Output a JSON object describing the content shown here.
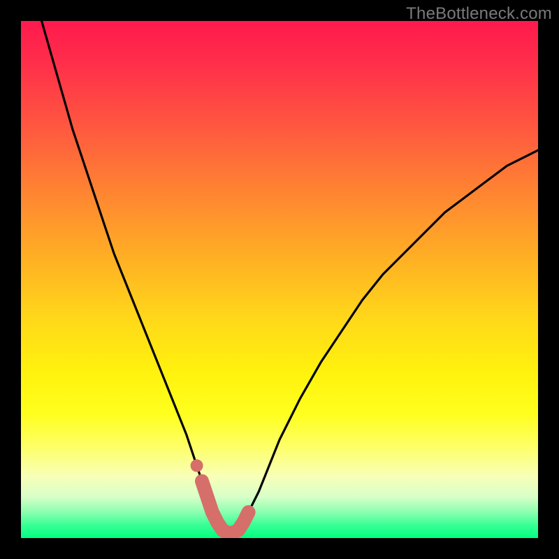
{
  "watermark": {
    "text": "TheBottleneck.com"
  },
  "colors": {
    "frame": "#000000",
    "curve": "#000000",
    "marker": "#d66e6a",
    "gradient_stops": [
      "#ff1a4d",
      "#ff2e4a",
      "#ff5640",
      "#ff8432",
      "#ffb024",
      "#ffd919",
      "#fff20e",
      "#ffff1e",
      "#feff63",
      "#f8ffb7",
      "#d8ffc8",
      "#8bffb0",
      "#38ff95",
      "#00ff80"
    ]
  },
  "chart_data": {
    "type": "line",
    "title": "",
    "xlabel": "",
    "ylabel": "",
    "xlim": [
      0,
      100
    ],
    "ylim": [
      0,
      100
    ],
    "grid": false,
    "legend": false,
    "series": [
      {
        "name": "bottleneck-curve",
        "x": [
          4,
          6,
          8,
          10,
          12,
          14,
          16,
          18,
          20,
          22,
          24,
          26,
          28,
          30,
          32,
          34,
          35,
          36,
          37,
          38,
          39,
          40,
          41,
          42,
          43,
          44,
          46,
          48,
          50,
          54,
          58,
          62,
          66,
          70,
          74,
          78,
          82,
          86,
          90,
          94,
          98,
          100
        ],
        "y": [
          100,
          93,
          86,
          79,
          73,
          67,
          61,
          55,
          50,
          45,
          40,
          35,
          30,
          25,
          20,
          14,
          11,
          8,
          5,
          3,
          1.5,
          1,
          1,
          1.5,
          3,
          5,
          9,
          14,
          19,
          27,
          34,
          40,
          46,
          51,
          55,
          59,
          63,
          66,
          69,
          72,
          74,
          75
        ]
      }
    ],
    "markers": {
      "name": "bottom-region",
      "shape": "rounded-caps",
      "x": [
        34,
        35,
        36,
        37,
        38,
        39,
        40,
        41,
        42,
        43,
        44
      ],
      "y": [
        14,
        11,
        8,
        5,
        3,
        1.5,
        1,
        1,
        1.5,
        3,
        5
      ]
    }
  }
}
